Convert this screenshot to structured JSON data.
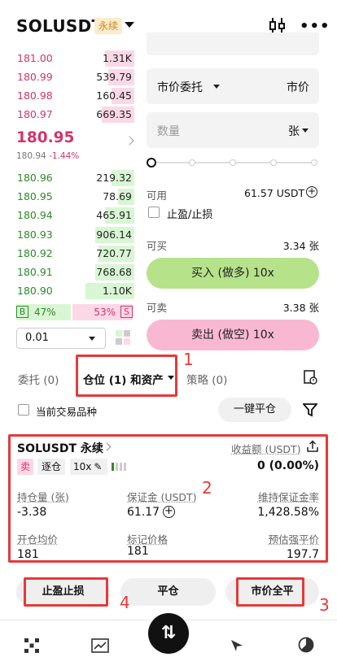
{
  "header": {
    "pair": "SOLUSDT",
    "tag": "永续"
  },
  "orderbook": {
    "asks": [
      {
        "price": "181.00",
        "qty": "1.31K",
        "fill": 0.45
      },
      {
        "price": "180.99",
        "qty": "539.79",
        "fill": 0.4
      },
      {
        "price": "180.98",
        "qty": "160.45",
        "fill": 0.35
      },
      {
        "price": "180.97",
        "qty": "669.35",
        "fill": 0.5
      }
    ],
    "mid": {
      "price": "180.95",
      "ref": "180.94",
      "change": "-1.44%"
    },
    "bids": [
      {
        "price": "180.96",
        "qty": "219.32",
        "fill": 0.35
      },
      {
        "price": "180.95",
        "qty": "78.69",
        "fill": 0.25
      },
      {
        "price": "180.94",
        "qty": "465.91",
        "fill": 0.45
      },
      {
        "price": "180.93",
        "qty": "906.14",
        "fill": 0.6
      },
      {
        "price": "180.92",
        "qty": "720.77",
        "fill": 0.55
      },
      {
        "price": "180.91",
        "qty": "768.68",
        "fill": 0.6
      },
      {
        "price": "180.90",
        "qty": "1.10K",
        "fill": 0.75
      }
    ],
    "ratio": {
      "buy_tag": "B",
      "buy_pct": "47%",
      "sell_pct": "53%",
      "sell_tag": "S",
      "buy_fraction": 0.47
    },
    "tick": "0.01"
  },
  "form": {
    "order_type": "市价委托",
    "price_mode": "市价",
    "qty_placeholder": "数量",
    "unit": "张",
    "available_label": "可用",
    "available_value": "61.57 USDT",
    "tpsl_label": "止盈/止损",
    "can_buy_label": "可买",
    "can_buy_value": "3.34 张",
    "buy_button": "买入 (做多) 10x",
    "can_sell_label": "可卖",
    "can_sell_value": "3.38 张",
    "sell_button": "卖出 (做空) 10x"
  },
  "tabs": {
    "orders": "委托 (0)",
    "positions": "仓位 (1) 和资产",
    "strategy": "策略 (0)"
  },
  "filter": {
    "current_only": "当前交易品种",
    "close_all": "一键平仓"
  },
  "position": {
    "symbol": "SOLUSDT 永续",
    "pnl_label": "收益额 (USDT)",
    "side": "卖",
    "margin_mode": "逐仓",
    "leverage": "10x",
    "pnl_value": "0 (0.00%)",
    "qty_label": "持仓量 (张)",
    "qty_value": "-3.38",
    "margin_label": "保证金 (USDT)",
    "margin_value": "61.17",
    "mmr_label": "维持保证金率",
    "mmr_value": "1,428.58%",
    "entry_label": "开仓均价",
    "entry_value": "181",
    "mark_label": "标记价格",
    "mark_value": "181",
    "liq_label": "预估强平价",
    "liq_value": "197.7"
  },
  "actions": {
    "tpsl": "止盈止损",
    "close": "平仓",
    "market_close": "市价全平"
  },
  "annotations": {
    "n1": "1",
    "n2": "2",
    "n3": "3",
    "n4": "4"
  },
  "colors": {
    "accent_green": "#b6e28a",
    "accent_pink": "#f9b8d2",
    "ask": "#d1356b",
    "bid": "#2e8a2a",
    "annotation": "#e53a3a"
  }
}
